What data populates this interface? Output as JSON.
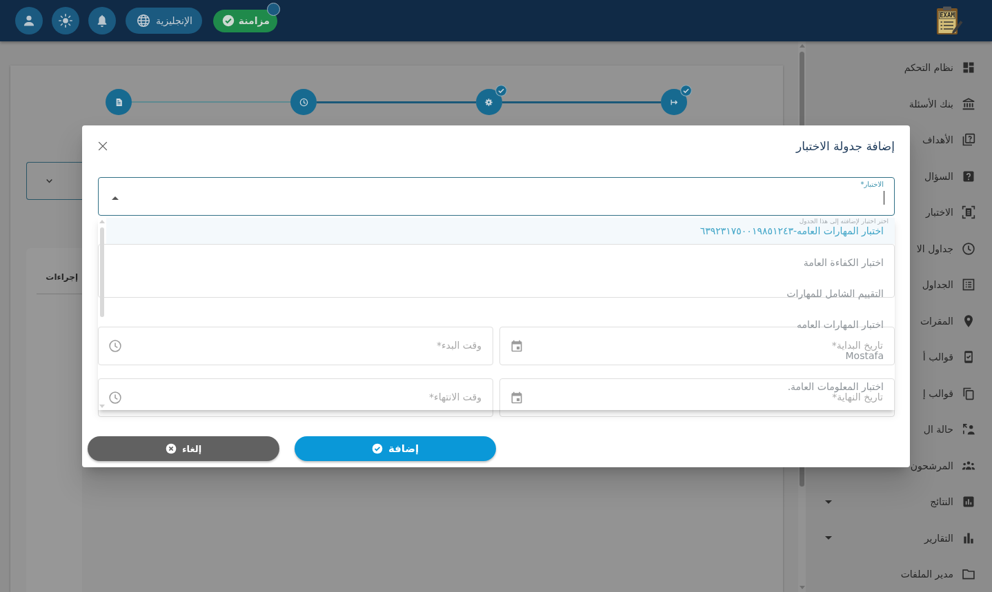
{
  "header": {
    "logo": {
      "text": "EXAM"
    },
    "sync": {
      "label": "مزامنة",
      "notification": true
    },
    "language": {
      "label": "الإنجليزية"
    }
  },
  "sidebar": {
    "items": [
      {
        "kind": "link",
        "label": "نظام التحكم"
      },
      {
        "kind": "link",
        "label": "بنك الأسئلة"
      },
      {
        "kind": "link",
        "label": "الأهداف"
      },
      {
        "kind": "link",
        "label": "السؤال"
      },
      {
        "kind": "link",
        "label": "الاختبار"
      },
      {
        "kind": "link",
        "label": "جداول الا"
      },
      {
        "kind": "link",
        "label": "الجداول"
      },
      {
        "kind": "link",
        "label": "المقرات"
      },
      {
        "kind": "link",
        "label": "قوالب أ"
      },
      {
        "kind": "link",
        "label": "قوالب إ"
      },
      {
        "kind": "link",
        "label": "حالة ال"
      },
      {
        "kind": "link",
        "label": "المرشحون"
      },
      {
        "kind": "group",
        "label": "النتائج",
        "expanded": false
      },
      {
        "kind": "group",
        "label": "التقارير",
        "expanded": false
      },
      {
        "kind": "link",
        "label": "مدير الملفات"
      }
    ]
  },
  "stepper": {
    "steps": [
      {
        "completed": true
      },
      {
        "completed": true
      },
      {
        "completed": false
      },
      {
        "completed": false
      }
    ]
  },
  "table": {
    "columns": [
      "إجراءات"
    ]
  },
  "dialog": {
    "title": "إضافة جدولة الاختبار",
    "select": {
      "label": "الاختبار*",
      "open": true,
      "hint": "اختر اختبار لإضافته إلى هذا الجدول",
      "options": [
        {
          "label": "اختبار المهارات العامه-٦٣٩٢٣١٧٥٠٠١٩٨٥١٢٤٣",
          "selected": true
        },
        {
          "label": "اختبار الكفاءة العامة",
          "selected": false
        },
        {
          "label": "التقييم الشامل للمهارات",
          "selected": false
        },
        {
          "label": "اختبار المهارات العامه",
          "selected": false
        },
        {
          "label": "Mostafa",
          "selected": false
        },
        {
          "label": "اختبار المعلومات العامة.",
          "selected": false
        }
      ]
    },
    "fields": [
      {
        "kind": "text"
      },
      {
        "kind": "date",
        "label": "تاريخ البداية*"
      },
      {
        "kind": "time",
        "label": "وقت البدء*"
      },
      {
        "kind": "date",
        "label": "تاريخ النهاية*"
      },
      {
        "kind": "time",
        "label": "وقت الانتهاء*"
      }
    ],
    "buttons": [
      {
        "kind": "submit",
        "label": "إضافة"
      },
      {
        "kind": "cancel",
        "label": "إلغاء"
      }
    ]
  }
}
